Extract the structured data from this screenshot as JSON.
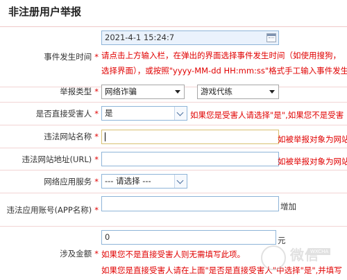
{
  "page": {
    "title": "非注册用户举报"
  },
  "fields": {
    "event_time": {
      "label": "事件发生时间",
      "required": "*",
      "value": "2021-4-1 15:24:7",
      "hint_line1": "请点击上方输入栏，在弹出的界面选择事件发生时间（如使用搜狗，",
      "hint_line2": "选择界面），或按照\"yyyy-MM-dd HH:mm:ss\"格式手工输入事件发生时"
    },
    "report_type": {
      "label": "举报类型",
      "required": "*",
      "primary_selected": "网络诈骗",
      "secondary_selected": "游戏代练"
    },
    "is_victim": {
      "label": "是否直接受害人",
      "required": "*",
      "selected": "是",
      "hint": "如果您是受害人请选择\"是\",如果您不是受害"
    },
    "site_name": {
      "label": "违法网站名称",
      "required": "*",
      "value": "",
      "hint": "如被举报对象为网站"
    },
    "site_url": {
      "label": "违法网站地址(URL)",
      "required": "*",
      "value": "",
      "hint": "如被举报对象为网站"
    },
    "app_service": {
      "label": "网络应用服务",
      "required": "*",
      "selected": "--- 请选择 ---"
    },
    "app_account": {
      "label": "违法应用账号(APP名称)",
      "required": "*",
      "value": "",
      "add_label": "增加"
    },
    "amount": {
      "label": "涉及金额",
      "required": "*",
      "value": "0",
      "unit": "元",
      "hint_line1": "如果您不是直接受害人则无需填写此项。",
      "hint_line2": "如果您是直接受害人请在上面\"是否是直接受害人\"中选择\"是\",并填写"
    }
  },
  "watermark": {
    "text": "微信",
    "badge": "WXCHA"
  },
  "colors": {
    "required_red": "#e00000",
    "input_border_blue": "#8eb4d8",
    "row_divider": "#f2d4d4"
  },
  "icons": [
    "calendar-icon",
    "dropdown-chevron-icon",
    "select-caret-icon"
  ]
}
